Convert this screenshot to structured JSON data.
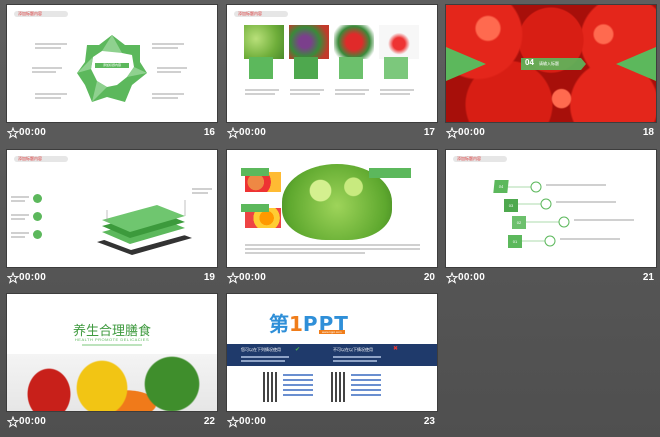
{
  "colors": {
    "background": "#575757",
    "accent_green": "#5cb85c",
    "tomato_red": "#d9261c",
    "ppt_blue": "#2f8fd8",
    "ppt_orange": "#f07d1a",
    "navy": "#1f3a6b"
  },
  "slides": [
    {
      "number": "16",
      "time": "00:00",
      "center_label": "添加标题内容",
      "tag": "添加标题内容"
    },
    {
      "number": "17",
      "time": "00:00",
      "tag": "添加标题内容"
    },
    {
      "number": "18",
      "time": "00:00",
      "section_number": "04",
      "section_title": "请输入标题"
    },
    {
      "number": "19",
      "time": "00:00",
      "tag": "添加标题内容"
    },
    {
      "number": "20",
      "time": "00:00"
    },
    {
      "number": "21",
      "time": "00:00",
      "tag": "添加标题内容",
      "steps": [
        "04",
        "03",
        "02",
        "01"
      ]
    },
    {
      "number": "22",
      "time": "00:00",
      "title": "养生合理膳食",
      "subtitle": "HEALTH PROMOTE DELICACIES"
    },
    {
      "number": "23",
      "time": "00:00",
      "logo_first": "第",
      "logo_digit": "1",
      "logo_rest": "PPT",
      "logo_url": "www.1ppt.com",
      "left_header": "您可以在下列情况使用",
      "right_header": "不可以在以下情况使用"
    }
  ]
}
